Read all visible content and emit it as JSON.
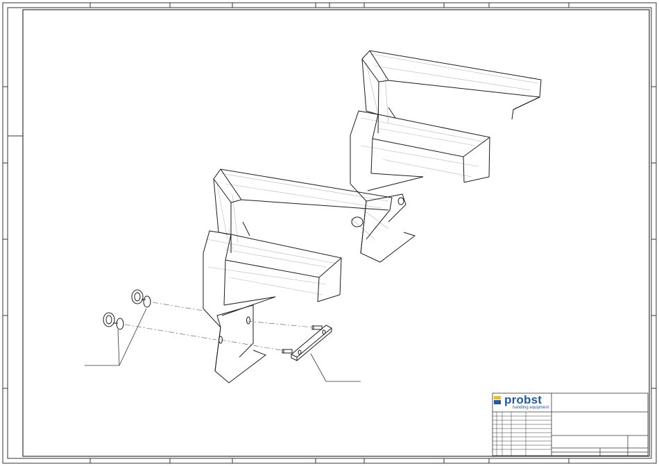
{
  "title_block": {
    "brand_name": "probst",
    "brand_tagline": "handling equipment",
    "brand_colors": {
      "blue": "#1f5aa6",
      "yellow": "#f2c300"
    }
  },
  "drawing": {
    "line_color": "#1a1a1a",
    "hidden_line_color": "#b0b0b0"
  }
}
